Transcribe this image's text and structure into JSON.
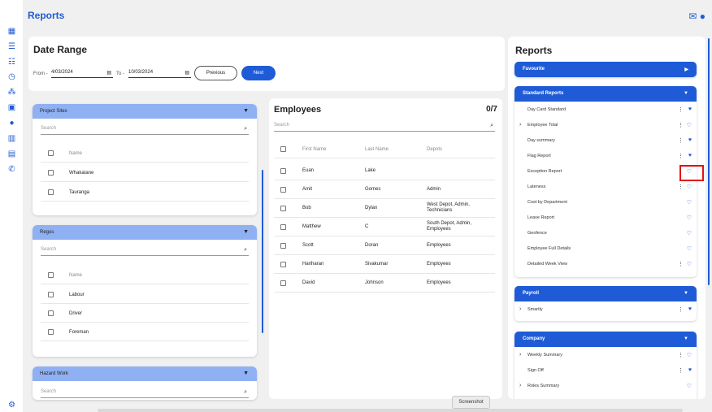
{
  "header": {
    "title": "Reports"
  },
  "date_range": {
    "title": "Date Range",
    "from_label": "From -",
    "from_value": "4/03/2024",
    "to_label": "To -",
    "to_value": "10/03/2024",
    "previous_label": "Previous",
    "next_label": "Next"
  },
  "project_sites": {
    "title": "Project Sites",
    "search_placeholder": "Search",
    "col_name": "Name",
    "rows": [
      "Whakatane",
      "Tauranga"
    ]
  },
  "regos": {
    "title": "Regos",
    "search_placeholder": "Search",
    "col_name": "Name",
    "rows": [
      "Labour",
      "Driver",
      "Foreman"
    ]
  },
  "hazard_work": {
    "title": "Hazard Work",
    "search_placeholder": "Search"
  },
  "employees": {
    "title": "Employees",
    "count": "0/7",
    "search_placeholder": "Search",
    "columns": [
      "First Name",
      "Last Name",
      "Depots"
    ],
    "rows": [
      {
        "first": "Euan",
        "last": "Lake",
        "depots": ""
      },
      {
        "first": "Amit",
        "last": "Gomes",
        "depots": "Admin"
      },
      {
        "first": "Bob",
        "last": "Dylan",
        "depots": "West Depot, Admin, Technicians"
      },
      {
        "first": "Matthew",
        "last": "C",
        "depots": "South Depot, Admin, Employees"
      },
      {
        "first": "Scott",
        "last": "Doran",
        "depots": "Employees"
      },
      {
        "first": "Hariharan",
        "last": "Sivakumar",
        "depots": "Employees"
      },
      {
        "first": "David",
        "last": "Johnson",
        "depots": "Employees"
      }
    ]
  },
  "reports_panel": {
    "title": "Reports",
    "favourite": {
      "title": "Favourite"
    },
    "standard": {
      "title": "Standard Reports",
      "items": [
        {
          "label": "Day Card Standard",
          "chevron": false,
          "favourite": true,
          "menu": true
        },
        {
          "label": "Employee Total",
          "chevron": true,
          "favourite": false,
          "menu": true
        },
        {
          "label": "Day summary",
          "chevron": false,
          "favourite": true,
          "menu": true
        },
        {
          "label": "Flag Report",
          "chevron": false,
          "favourite": true,
          "menu": true
        },
        {
          "label": "Exception Report",
          "chevron": false,
          "favourite": false,
          "menu": true
        },
        {
          "label": "Lateness",
          "chevron": false,
          "favourite": false,
          "menu": true
        },
        {
          "label": "Cost by Department",
          "chevron": false,
          "favourite": false,
          "menu": false
        },
        {
          "label": "Leave Report",
          "chevron": false,
          "favourite": false,
          "menu": false
        },
        {
          "label": "Geofence",
          "chevron": false,
          "favourite": false,
          "menu": false
        },
        {
          "label": "Employee Full Details",
          "chevron": false,
          "favourite": false,
          "menu": false
        },
        {
          "label": "Detailed Week View",
          "chevron": false,
          "favourite": false,
          "menu": true
        }
      ]
    },
    "payroll": {
      "title": "Payroll",
      "items": [
        {
          "label": "Smartly",
          "chevron": true,
          "favourite": true,
          "menu": true
        }
      ]
    },
    "company": {
      "title": "Company",
      "items": [
        {
          "label": "Weekly Summary",
          "chevron": true,
          "favourite": false,
          "menu": true
        },
        {
          "label": "Sign Off",
          "chevron": false,
          "favourite": true,
          "menu": true
        },
        {
          "label": "Roles Summary",
          "chevron": true,
          "favourite": false,
          "menu": false
        }
      ]
    }
  },
  "tooltip": {
    "text": "Screenshot"
  },
  "colors": {
    "accent": "#1f5bd6",
    "accordion_header": "#8fb0f3",
    "highlight": "#e01313"
  }
}
